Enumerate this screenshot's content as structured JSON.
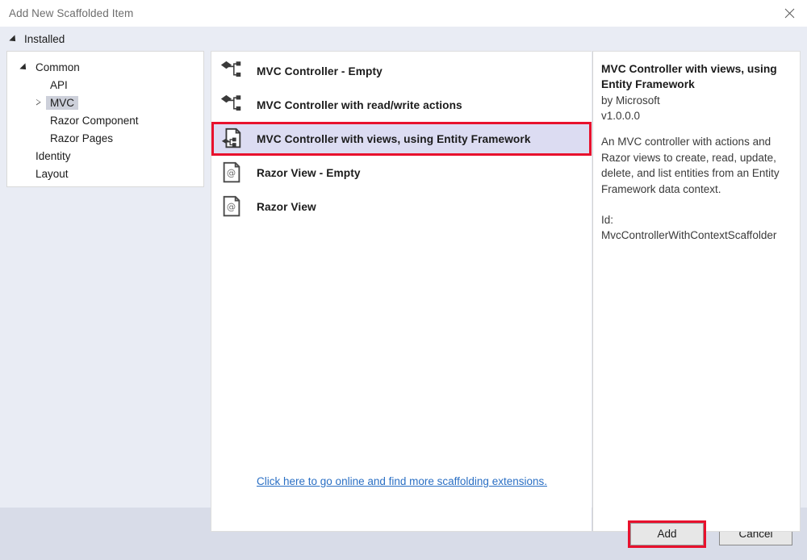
{
  "window": {
    "title": "Add New Scaffolded Item",
    "close_icon": "close-icon"
  },
  "installed": {
    "label": "Installed",
    "expander_icon": "triangle-down-icon"
  },
  "tree": {
    "nodes": [
      {
        "label": "Common",
        "level": 0,
        "expander": "triangle-down-icon",
        "selected": false
      },
      {
        "label": "API",
        "level": 1,
        "expander": "none",
        "selected": false
      },
      {
        "label": "MVC",
        "level": 1,
        "expander": "triangle-right-icon",
        "selected": true
      },
      {
        "label": "Razor Component",
        "level": 1,
        "expander": "none",
        "selected": false
      },
      {
        "label": "Razor Pages",
        "level": 1,
        "expander": "none",
        "selected": false
      },
      {
        "label": "Identity",
        "level": 0,
        "expander": "none",
        "selected": false
      },
      {
        "label": "Layout",
        "level": 0,
        "expander": "none",
        "selected": false
      }
    ]
  },
  "list": {
    "items": [
      {
        "label": "MVC Controller - Empty",
        "icon": "mvc-controller-icon",
        "selected": false
      },
      {
        "label": "MVC Controller with read/write actions",
        "icon": "mvc-controller-icon",
        "selected": false
      },
      {
        "label": "MVC Controller with views, using Entity Framework",
        "icon": "mvc-controller-with-views-icon",
        "selected": true
      },
      {
        "label": "Razor View - Empty",
        "icon": "razor-view-icon",
        "selected": false
      },
      {
        "label": "Razor View",
        "icon": "razor-view-icon",
        "selected": false
      }
    ],
    "extension_link": "Click here to go online and find more scaffolding extensions."
  },
  "details": {
    "title": "MVC Controller with views, using Entity Framework",
    "author": "by Microsoft",
    "version": "v1.0.0.0",
    "description": "An MVC controller with actions and Razor views to create, read, update, delete, and list entities from an Entity Framework data context.",
    "id": "Id: MvcControllerWithContextScaffolder"
  },
  "footer": {
    "add_label": "Add",
    "cancel_label": "Cancel"
  },
  "colors": {
    "dialog_background": "#e9ecf4",
    "footer_background": "#d8dce8",
    "selection_highlight": "#dcdcf2",
    "annotation_red": "#e8112d",
    "link_blue": "#2a6fc4",
    "tree_selection": "#cdd0da"
  }
}
